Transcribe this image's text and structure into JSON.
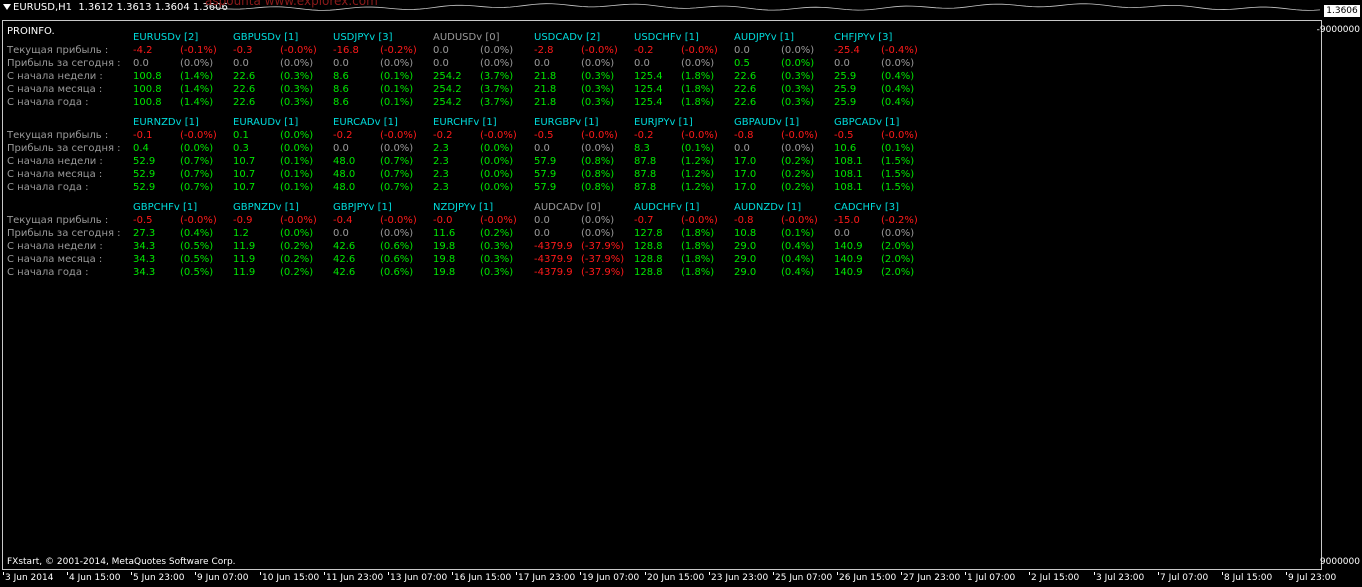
{
  "window": {
    "symbol_period": "EURUSD,H1",
    "ohlc": "1.3612 1.3613 1.3604 1.3606",
    "watermark": "aspounta www.explorex.com",
    "current_price": "1.3606"
  },
  "price_axis": {
    "top": "-9000000",
    "bottom": "9000000"
  },
  "indicator": {
    "label": "PROINFO."
  },
  "row_labels": [
    "Текущая прибыль :",
    "Прибыль за сегодня :",
    "С начала недели :",
    "С начала месяца :",
    "С начала года :"
  ],
  "blocks": [
    {
      "pairs": [
        {
          "name": "EURUSDv [2]",
          "active": true,
          "rows": [
            [
              "-4.2",
              "(-0.1%)"
            ],
            [
              "0.0",
              "(0.0%)"
            ],
            [
              "100.8",
              "(1.4%)"
            ],
            [
              "100.8",
              "(1.4%)"
            ],
            [
              "100.8",
              "(1.4%)"
            ]
          ]
        },
        {
          "name": "GBPUSDv [1]",
          "active": true,
          "rows": [
            [
              "-0.3",
              "(-0.0%)"
            ],
            [
              "0.0",
              "(0.0%)"
            ],
            [
              "22.6",
              "(0.3%)"
            ],
            [
              "22.6",
              "(0.3%)"
            ],
            [
              "22.6",
              "(0.3%)"
            ]
          ]
        },
        {
          "name": "USDJPYv [3]",
          "active": true,
          "rows": [
            [
              "-16.8",
              "(-0.2%)"
            ],
            [
              "0.0",
              "(0.0%)"
            ],
            [
              "8.6",
              "(0.1%)"
            ],
            [
              "8.6",
              "(0.1%)"
            ],
            [
              "8.6",
              "(0.1%)"
            ]
          ]
        },
        {
          "name": "AUDUSDv [0]",
          "active": false,
          "rows": [
            [
              "0.0",
              "(0.0%)"
            ],
            [
              "0.0",
              "(0.0%)"
            ],
            [
              "254.2",
              "(3.7%)"
            ],
            [
              "254.2",
              "(3.7%)"
            ],
            [
              "254.2",
              "(3.7%)"
            ]
          ]
        },
        {
          "name": "USDCADv [2]",
          "active": true,
          "rows": [
            [
              "-2.8",
              "(-0.0%)"
            ],
            [
              "0.0",
              "(0.0%)"
            ],
            [
              "21.8",
              "(0.3%)"
            ],
            [
              "21.8",
              "(0.3%)"
            ],
            [
              "21.8",
              "(0.3%)"
            ]
          ]
        },
        {
          "name": "USDCHFv [1]",
          "active": true,
          "rows": [
            [
              "-0.2",
              "(-0.0%)"
            ],
            [
              "0.0",
              "(0.0%)"
            ],
            [
              "125.4",
              "(1.8%)"
            ],
            [
              "125.4",
              "(1.8%)"
            ],
            [
              "125.4",
              "(1.8%)"
            ]
          ]
        },
        {
          "name": "AUDJPYv [1]",
          "active": true,
          "rows": [
            [
              "0.0",
              "(0.0%)"
            ],
            [
              "0.5",
              "(0.0%)"
            ],
            [
              "22.6",
              "(0.3%)"
            ],
            [
              "22.6",
              "(0.3%)"
            ],
            [
              "22.6",
              "(0.3%)"
            ]
          ]
        },
        {
          "name": "CHFJPYv [3]",
          "active": true,
          "rows": [
            [
              "-25.4",
              "(-0.4%)"
            ],
            [
              "0.0",
              "(0.0%)"
            ],
            [
              "25.9",
              "(0.4%)"
            ],
            [
              "25.9",
              "(0.4%)"
            ],
            [
              "25.9",
              "(0.4%)"
            ]
          ]
        }
      ]
    },
    {
      "pairs": [
        {
          "name": "EURNZDv [1]",
          "active": true,
          "rows": [
            [
              "-0.1",
              "(-0.0%)"
            ],
            [
              "0.4",
              "(0.0%)"
            ],
            [
              "52.9",
              "(0.7%)"
            ],
            [
              "52.9",
              "(0.7%)"
            ],
            [
              "52.9",
              "(0.7%)"
            ]
          ]
        },
        {
          "name": "EURAUDv [1]",
          "active": true,
          "rows": [
            [
              "0.1",
              "(0.0%)"
            ],
            [
              "0.3",
              "(0.0%)"
            ],
            [
              "10.7",
              "(0.1%)"
            ],
            [
              "10.7",
              "(0.1%)"
            ],
            [
              "10.7",
              "(0.1%)"
            ]
          ]
        },
        {
          "name": "EURCADv [1]",
          "active": true,
          "rows": [
            [
              "-0.2",
              "(-0.0%)"
            ],
            [
              "0.0",
              "(0.0%)"
            ],
            [
              "48.0",
              "(0.7%)"
            ],
            [
              "48.0",
              "(0.7%)"
            ],
            [
              "48.0",
              "(0.7%)"
            ]
          ]
        },
        {
          "name": "EURCHFv [1]",
          "active": true,
          "rows": [
            [
              "-0.2",
              "(-0.0%)"
            ],
            [
              "2.3",
              "(0.0%)"
            ],
            [
              "2.3",
              "(0.0%)"
            ],
            [
              "2.3",
              "(0.0%)"
            ],
            [
              "2.3",
              "(0.0%)"
            ]
          ]
        },
        {
          "name": "EURGBPv [1]",
          "active": true,
          "rows": [
            [
              "-0.5",
              "(-0.0%)"
            ],
            [
              "0.0",
              "(0.0%)"
            ],
            [
              "57.9",
              "(0.8%)"
            ],
            [
              "57.9",
              "(0.8%)"
            ],
            [
              "57.9",
              "(0.8%)"
            ]
          ]
        },
        {
          "name": "EURJPYv [1]",
          "active": true,
          "rows": [
            [
              "-0.2",
              "(-0.0%)"
            ],
            [
              "8.3",
              "(0.1%)"
            ],
            [
              "87.8",
              "(1.2%)"
            ],
            [
              "87.8",
              "(1.2%)"
            ],
            [
              "87.8",
              "(1.2%)"
            ]
          ]
        },
        {
          "name": "GBPAUDv [1]",
          "active": true,
          "rows": [
            [
              "-0.8",
              "(-0.0%)"
            ],
            [
              "0.0",
              "(0.0%)"
            ],
            [
              "17.0",
              "(0.2%)"
            ],
            [
              "17.0",
              "(0.2%)"
            ],
            [
              "17.0",
              "(0.2%)"
            ]
          ]
        },
        {
          "name": "GBPCADv [1]",
          "active": true,
          "rows": [
            [
              "-0.5",
              "(-0.0%)"
            ],
            [
              "10.6",
              "(0.1%)"
            ],
            [
              "108.1",
              "(1.5%)"
            ],
            [
              "108.1",
              "(1.5%)"
            ],
            [
              "108.1",
              "(1.5%)"
            ]
          ]
        }
      ]
    },
    {
      "pairs": [
        {
          "name": "GBPCHFv [1]",
          "active": true,
          "rows": [
            [
              "-0.5",
              "(-0.0%)"
            ],
            [
              "27.3",
              "(0.4%)"
            ],
            [
              "34.3",
              "(0.5%)"
            ],
            [
              "34.3",
              "(0.5%)"
            ],
            [
              "34.3",
              "(0.5%)"
            ]
          ]
        },
        {
          "name": "GBPNZDv [1]",
          "active": true,
          "rows": [
            [
              "-0.9",
              "(-0.0%)"
            ],
            [
              "1.2",
              "(0.0%)"
            ],
            [
              "11.9",
              "(0.2%)"
            ],
            [
              "11.9",
              "(0.2%)"
            ],
            [
              "11.9",
              "(0.2%)"
            ]
          ]
        },
        {
          "name": "GBPJPYv [1]",
          "active": true,
          "rows": [
            [
              "-0.4",
              "(-0.0%)"
            ],
            [
              "0.0",
              "(0.0%)"
            ],
            [
              "42.6",
              "(0.6%)"
            ],
            [
              "42.6",
              "(0.6%)"
            ],
            [
              "42.6",
              "(0.6%)"
            ]
          ]
        },
        {
          "name": "NZDJPYv [1]",
          "active": true,
          "rows": [
            [
              "-0.0",
              "(-0.0%)"
            ],
            [
              "11.6",
              "(0.2%)"
            ],
            [
              "19.8",
              "(0.3%)"
            ],
            [
              "19.8",
              "(0.3%)"
            ],
            [
              "19.8",
              "(0.3%)"
            ]
          ]
        },
        {
          "name": "AUDCADv [0]",
          "active": false,
          "rows": [
            [
              "0.0",
              "(0.0%)"
            ],
            [
              "0.0",
              "(0.0%)"
            ],
            [
              "-4379.9",
              "(-37.9%)"
            ],
            [
              "-4379.9",
              "(-37.9%)"
            ],
            [
              "-4379.9",
              "(-37.9%)"
            ]
          ]
        },
        {
          "name": "AUDCHFv [1]",
          "active": true,
          "rows": [
            [
              "-0.7",
              "(-0.0%)"
            ],
            [
              "127.8",
              "(1.8%)"
            ],
            [
              "128.8",
              "(1.8%)"
            ],
            [
              "128.8",
              "(1.8%)"
            ],
            [
              "128.8",
              "(1.8%)"
            ]
          ]
        },
        {
          "name": "AUDNZDv [1]",
          "active": true,
          "rows": [
            [
              "-0.8",
              "(-0.0%)"
            ],
            [
              "10.8",
              "(0.1%)"
            ],
            [
              "29.0",
              "(0.4%)"
            ],
            [
              "29.0",
              "(0.4%)"
            ],
            [
              "29.0",
              "(0.4%)"
            ]
          ]
        },
        {
          "name": "CADCHFv [3]",
          "active": true,
          "rows": [
            [
              "-15.0",
              "(-0.2%)"
            ],
            [
              "0.0",
              "(0.0%)"
            ],
            [
              "140.9",
              "(2.0%)"
            ],
            [
              "140.9",
              "(2.0%)"
            ],
            [
              "140.9",
              "(2.0%)"
            ]
          ]
        }
      ]
    }
  ],
  "copyright": "FXstart, © 2001-2014, MetaQuotes Software Corp.",
  "time_axis": [
    "3 Jun 2014",
    "4 Jun 15:00",
    "5 Jun 23:00",
    "9 Jun 07:00",
    "10 Jun 15:00",
    "11 Jun 23:00",
    "13 Jun 07:00",
    "16 Jun 15:00",
    "17 Jun 23:00",
    "19 Jun 07:00",
    "20 Jun 15:00",
    "23 Jun 23:00",
    "25 Jun 07:00",
    "26 Jun 15:00",
    "27 Jun 23:00",
    "1 Jul 07:00",
    "2 Jul 15:00",
    "3 Jul 23:00",
    "7 Jul 07:00",
    "8 Jul 15:00",
    "9 Jul 23:00"
  ],
  "colors": {
    "positive": "#00e600",
    "negative": "#ff1a1a",
    "neutral": "#9a9a9a",
    "header_active": "#00dcdc"
  }
}
